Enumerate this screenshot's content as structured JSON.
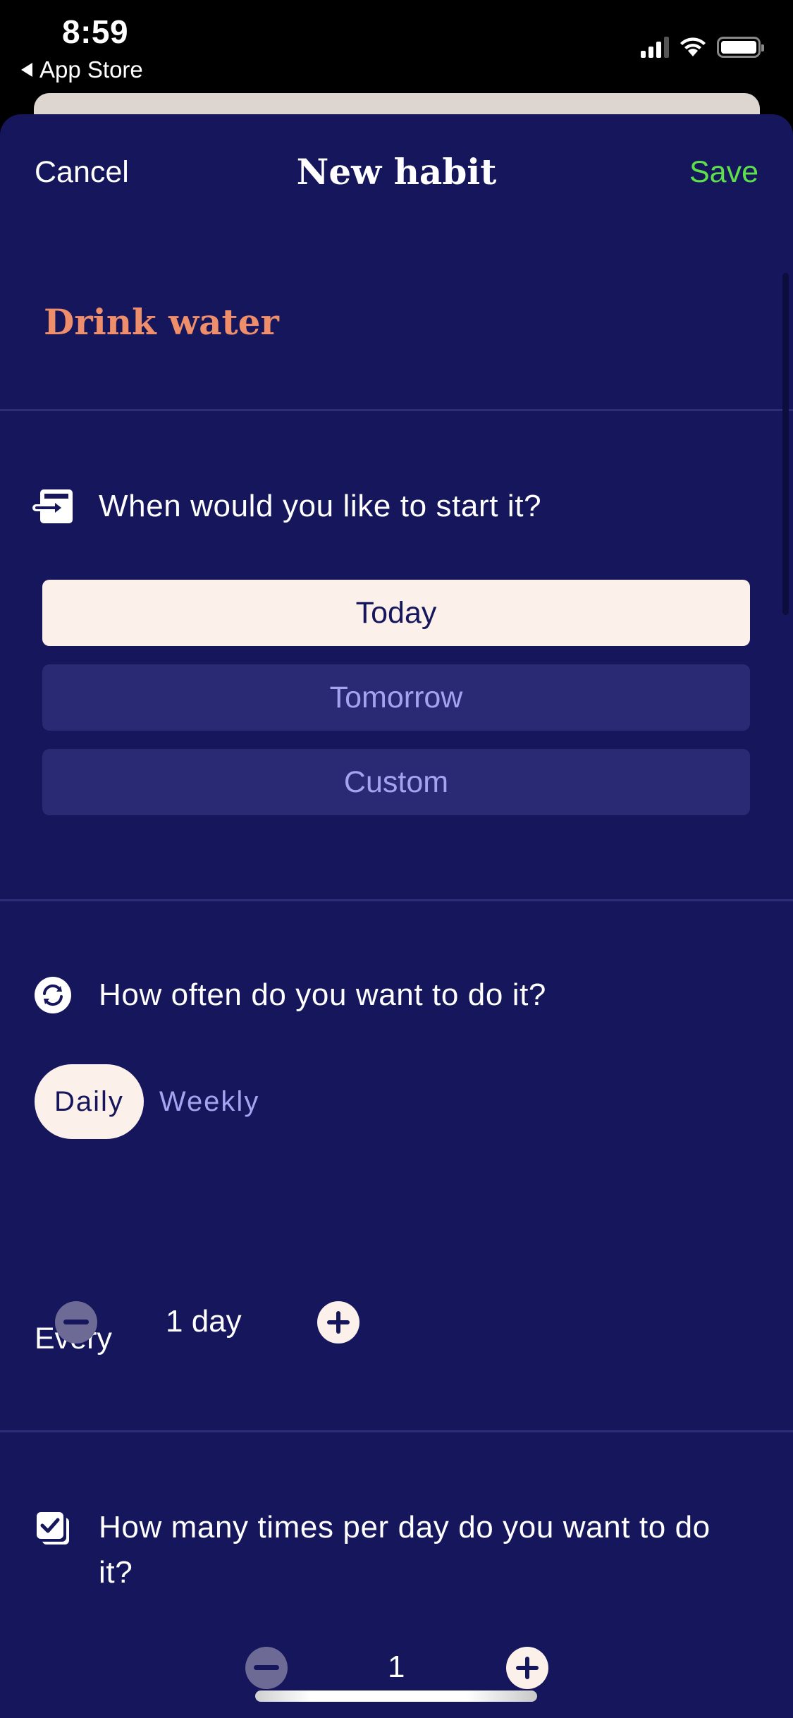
{
  "status_bar": {
    "time": "8:59",
    "back_label": "App Store",
    "icons": [
      "signal-icon",
      "wifi-icon",
      "battery-icon"
    ]
  },
  "nav": {
    "cancel_label": "Cancel",
    "title": "New habit",
    "save_label": "Save"
  },
  "habit": {
    "name": "Drink water"
  },
  "start_section": {
    "icon": "start-arrow-icon",
    "question": "When would you like to start it?",
    "options": [
      {
        "label": "Today",
        "selected": true
      },
      {
        "label": "Tomorrow",
        "selected": false
      },
      {
        "label": "Custom",
        "selected": false
      }
    ]
  },
  "frequency_section": {
    "icon": "repeat-icon",
    "question": "How often do you want to do it?",
    "tabs": [
      {
        "label": "Daily",
        "selected": true
      },
      {
        "label": "Weekly",
        "selected": false
      }
    ],
    "every_label": "Every",
    "interval_value": "1 day"
  },
  "times_section": {
    "icon": "checklist-icon",
    "question": "How many times per day do you want to do it?",
    "count_value": "1"
  },
  "colors": {
    "background": "#16165c",
    "accent_save": "#5de04a",
    "habit_name": "#ee8e6b",
    "selected_fill": "#fcf0eb",
    "unselected_fill": "#2a2a74",
    "unselected_text": "#a3a3f0"
  }
}
